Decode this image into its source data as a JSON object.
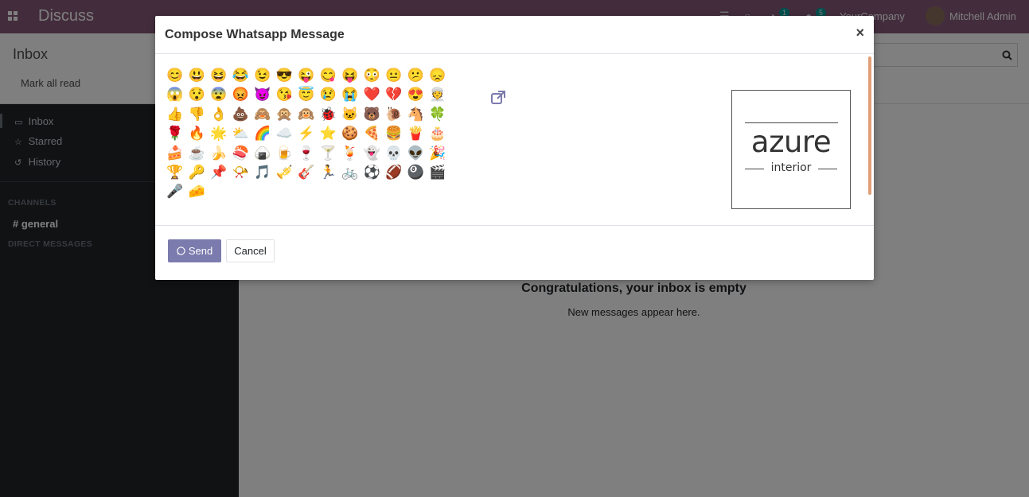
{
  "navbar": {
    "app_title": "Discuss",
    "activity_count": "1",
    "messages_count": "5",
    "company": "YourCompany",
    "user_name": "Mitchell Admin"
  },
  "control_panel": {
    "title": "Inbox",
    "mark_all_read": "Mark all read"
  },
  "sidebar": {
    "items": [
      {
        "label": "Inbox",
        "icon": "inbox-icon"
      },
      {
        "label": "Starred",
        "icon": "star-icon"
      },
      {
        "label": "History",
        "icon": "history-icon"
      }
    ],
    "channels_header": "CHANNELS",
    "channel": "general",
    "direct_messages_header": "DIRECT MESSAGES"
  },
  "main": {
    "empty_title": "Congratulations, your inbox is empty",
    "empty_subtitle": "New messages appear here."
  },
  "dialog": {
    "title": "Compose Whatsapp Message",
    "close_symbol": "×",
    "emojis": [
      "😊",
      "😃",
      "😆",
      "😂",
      "😉",
      "😎",
      "😜",
      "😋",
      "😝",
      "😳",
      "😐",
      "😕",
      "😞",
      "😱",
      "😯",
      "😨",
      "😡",
      "😈",
      "😘",
      "😇",
      "😢",
      "😭",
      "❤️",
      "💔",
      "😍",
      "👳",
      "👍",
      "👎",
      "👌",
      "💩",
      "🙈",
      "🙊",
      "🙉",
      "🐞",
      "🐱",
      "🐻",
      "🐌",
      "🐴",
      "🍀",
      "🌹",
      "🔥",
      "🌟",
      "⛅",
      "🌈",
      "☁️",
      "⚡",
      "⭐",
      "🍪",
      "🍕",
      "🍔",
      "🍟",
      "🎂",
      "🍰",
      "☕",
      "🍌",
      "🍣",
      "🍙",
      "🍺",
      "🍷",
      "🍸",
      "🍹",
      "👻",
      "💀",
      "👽",
      "🎉",
      "🏆",
      "🔑",
      "📌",
      "📯",
      "🎵",
      "🎺",
      "🎸",
      "🏃",
      "🚲",
      "⚽",
      "🏈",
      "🎱",
      "🎬",
      "🎤",
      "🧀"
    ],
    "logo_main": "azure",
    "logo_sub": "interior",
    "send_label": "Send",
    "cancel_label": "Cancel",
    "accent_color": "#7c7bad"
  }
}
